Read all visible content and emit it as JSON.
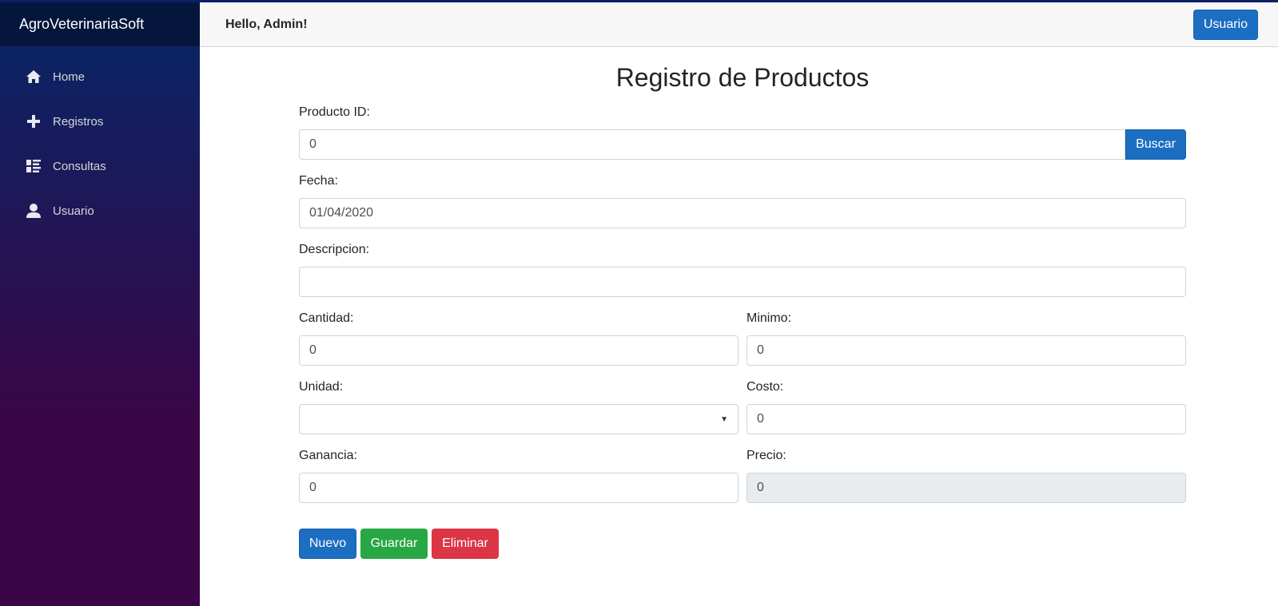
{
  "brand": "AgroVeterinariaSoft",
  "nav": [
    {
      "label": "Home",
      "icon": "home-icon"
    },
    {
      "label": "Registros",
      "icon": "plus-icon"
    },
    {
      "label": "Consultas",
      "icon": "list-icon"
    },
    {
      "label": "Usuario",
      "icon": "user-icon"
    }
  ],
  "header": {
    "greeting": "Hello, Admin!",
    "user_button": "Usuario"
  },
  "page_title": "Registro de Productos",
  "form": {
    "producto_id": {
      "label": "Producto ID:",
      "value": "0",
      "button": "Buscar"
    },
    "fecha": {
      "label": "Fecha:",
      "value": "01/04/2020"
    },
    "descripcion": {
      "label": "Descripcion:",
      "value": ""
    },
    "cantidad": {
      "label": "Cantidad:",
      "value": "0"
    },
    "minimo": {
      "label": "Minimo:",
      "value": "0"
    },
    "unidad": {
      "label": "Unidad:",
      "value": ""
    },
    "costo": {
      "label": "Costo:",
      "value": "0"
    },
    "ganancia": {
      "label": "Ganancia:",
      "value": "0"
    },
    "precio": {
      "label": "Precio:",
      "value": "0"
    }
  },
  "actions": {
    "nuevo": "Nuevo",
    "guardar": "Guardar",
    "eliminar": "Eliminar"
  },
  "colors": {
    "primary": "#1b6ec2",
    "success": "#28a745",
    "danger": "#dc3545"
  }
}
